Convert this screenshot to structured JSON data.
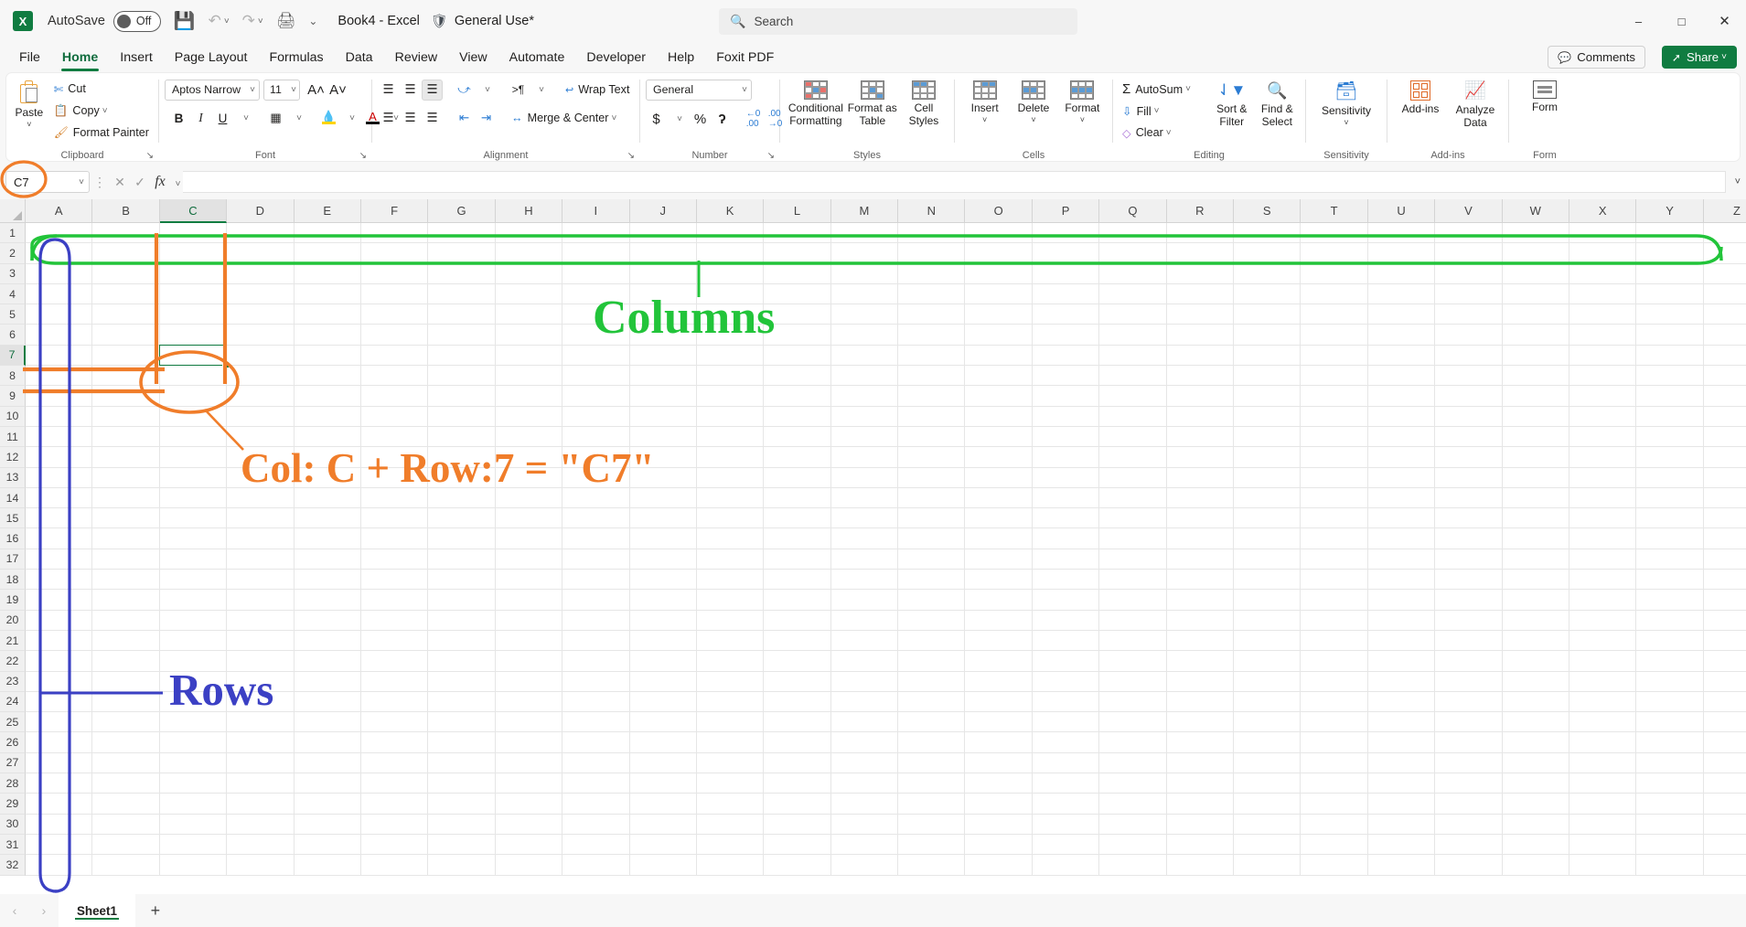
{
  "titlebar": {
    "app_icon": "excel-logo",
    "autosave_label": "AutoSave",
    "autosave_state": "Off",
    "save_icon": "save-icon",
    "undo_icon": "undo-icon",
    "redo_icon": "redo-icon",
    "print_icon": "quick-print-icon",
    "customize_icon": "customize-quick-access-icon",
    "document_title": "Book4  -  Excel",
    "sensitivity_shield": "shield-icon",
    "sensitivity_label": "General Use*",
    "search_placeholder": "Search",
    "search_icon": "search-icon",
    "minimize": "–",
    "maximize": "□",
    "close": "✕"
  },
  "tabs": [
    {
      "label": "File",
      "active": false
    },
    {
      "label": "Home",
      "active": true
    },
    {
      "label": "Insert",
      "active": false
    },
    {
      "label": "Page Layout",
      "active": false
    },
    {
      "label": "Formulas",
      "active": false
    },
    {
      "label": "Data",
      "active": false
    },
    {
      "label": "Review",
      "active": false
    },
    {
      "label": "View",
      "active": false
    },
    {
      "label": "Automate",
      "active": false
    },
    {
      "label": "Developer",
      "active": false
    },
    {
      "label": "Help",
      "active": false
    },
    {
      "label": "Foxit PDF",
      "active": false
    }
  ],
  "tabrow_right": {
    "comments_label": "Comments",
    "comments_icon": "comment-icon",
    "share_label": "Share",
    "share_icon": "share-icon",
    "share_color": "#107c41"
  },
  "ribbon": {
    "clipboard": {
      "group_label": "Clipboard",
      "paste_label": "Paste",
      "cut_label": "Cut",
      "copy_label": "Copy",
      "format_painter_label": "Format Painter",
      "dialog_launcher": "↘"
    },
    "font": {
      "group_label": "Font",
      "font_name": "Aptos Narrow",
      "font_size": "11",
      "grow_font": "A˄",
      "shrink_font": "A˅",
      "bold": "B",
      "italic": "I",
      "underline": "U",
      "borders": "borders-icon",
      "fill_color": "fill-color-icon",
      "font_color": "font-color-icon",
      "dialog_launcher": "↘"
    },
    "alignment": {
      "group_label": "Alignment",
      "align_top": "align-top-icon",
      "align_middle": "align-middle-icon",
      "align_bottom": "align-bottom-icon",
      "orientation": "orientation-icon",
      "text_direction": "text-direction-icon",
      "align_left": "align-left-icon",
      "align_center": "align-center-icon",
      "align_right": "align-right-icon",
      "decrease_indent": "decrease-indent-icon",
      "increase_indent": "increase-indent-icon",
      "wrap_text_label": "Wrap Text",
      "merge_center_label": "Merge & Center",
      "dialog_launcher": "↘"
    },
    "number": {
      "group_label": "Number",
      "format_value": "General",
      "currency": "$",
      "percent": "%",
      "comma": "ʔ",
      "increase_decimal": "increase-decimal-icon",
      "decrease_decimal": "decrease-decimal-icon",
      "dialog_launcher": "↘"
    },
    "styles": {
      "group_label": "Styles",
      "conditional_formatting_label": "Conditional\nFormatting",
      "format_as_table_label": "Format as\nTable",
      "cell_styles_label": "Cell\nStyles"
    },
    "cells": {
      "group_label": "Cells",
      "insert_label": "Insert",
      "delete_label": "Delete",
      "format_label": "Format"
    },
    "editing": {
      "group_label": "Editing",
      "autosum_label": "AutoSum",
      "fill_label": "Fill",
      "clear_label": "Clear",
      "sort_filter_label": "Sort &\nFilter",
      "find_select_label": "Find &\nSelect"
    },
    "sensitivity": {
      "group_label": "Sensitivity",
      "button_label": "Sensitivity"
    },
    "addins": {
      "group_label": "Add-ins",
      "button_label": "Add-ins",
      "analyze_data_label": "Analyze\nData"
    },
    "form": {
      "group_label": "Form",
      "button_label": "Form"
    }
  },
  "formula_bar": {
    "name_box_value": "C7",
    "cancel_icon": "cancel-icon",
    "enter_icon": "confirm-icon",
    "insert_function_icon": "fx-icon",
    "formula_value": "",
    "expand_icon": "expand-formula-bar-icon",
    "more_icon": "more-options-icon"
  },
  "grid": {
    "columns": [
      "A",
      "B",
      "C",
      "D",
      "E",
      "F",
      "G",
      "H",
      "I",
      "J",
      "K",
      "L",
      "M",
      "N",
      "O",
      "P",
      "Q",
      "R",
      "S",
      "T",
      "U",
      "V",
      "W",
      "X",
      "Y",
      "Z"
    ],
    "rows": [
      1,
      2,
      3,
      4,
      5,
      6,
      7,
      8,
      9,
      10,
      11,
      12,
      13,
      14,
      15,
      16,
      17,
      18,
      19,
      20,
      21,
      22,
      23,
      24,
      25,
      26,
      27,
      28,
      29,
      30,
      31,
      32
    ],
    "selected_cell": "C7",
    "selected_column": "C",
    "selected_row": 7,
    "cell_content": ""
  },
  "annotations": {
    "columns_label": "Columns",
    "columns_color": "#22c43a",
    "rows_label": "Rows",
    "rows_color": "#3b40c4",
    "cell_label": "Col: C + Row:7 = \"C7\"",
    "cell_color": "#f07d2a"
  },
  "sheetbar": {
    "prev_icon": "‹",
    "next_icon": "›",
    "sheets": [
      {
        "name": "Sheet1",
        "active": true
      }
    ],
    "add_sheet_icon": "+"
  }
}
